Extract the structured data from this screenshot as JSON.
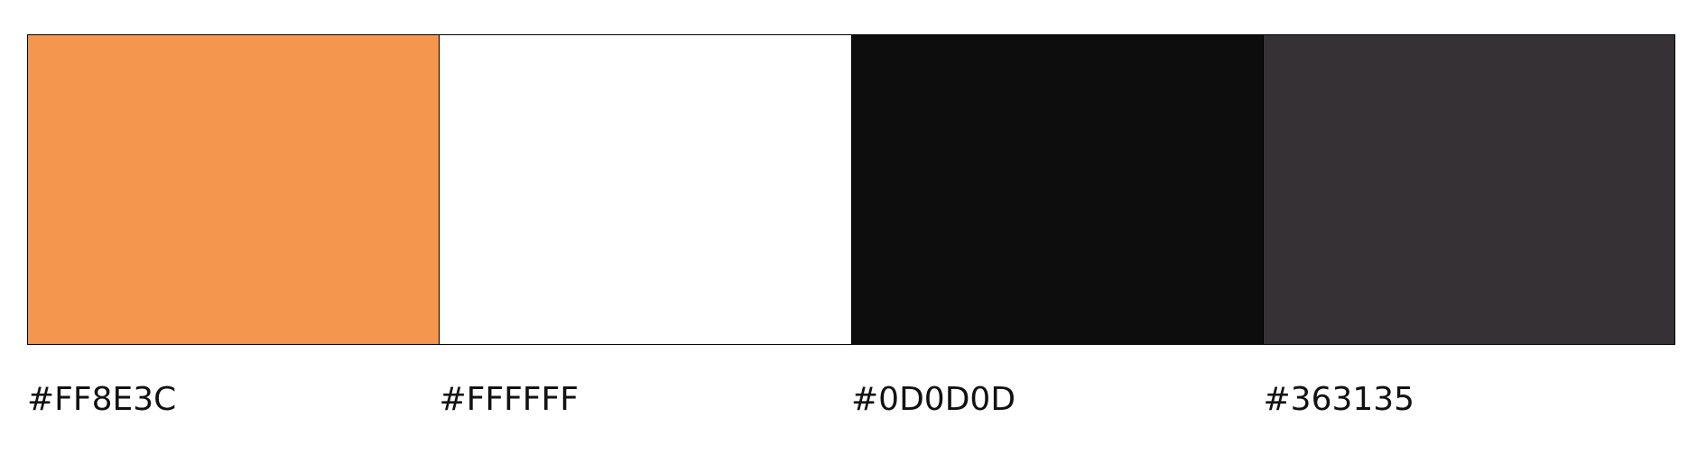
{
  "palette": {
    "swatches": [
      {
        "color": "#F5964E",
        "label": "#FF8E3C"
      },
      {
        "color": "#FFFFFF",
        "label": "#FFFFFF"
      },
      {
        "color": "#0D0D0D",
        "label": "#0D0D0D"
      },
      {
        "color": "#363135",
        "label": "#363135"
      }
    ]
  }
}
